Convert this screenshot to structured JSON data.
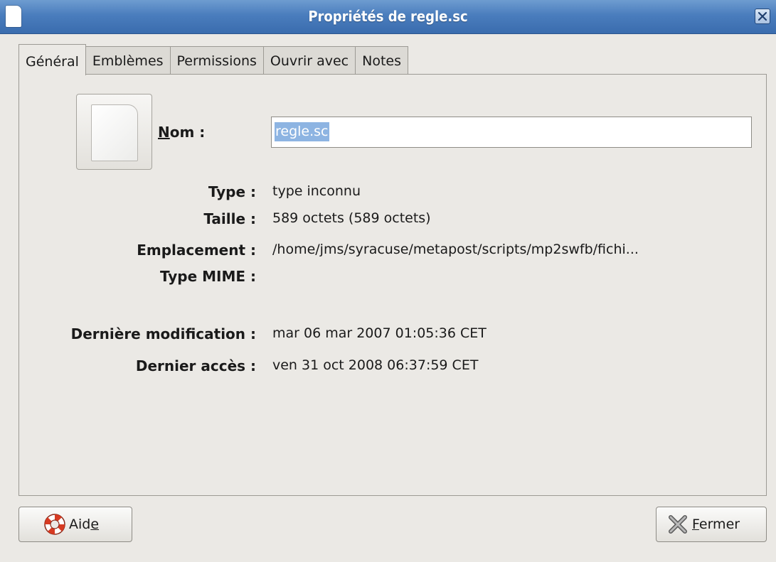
{
  "window": {
    "title": "Propriétés de regle.sc",
    "doc_icon": "document-icon",
    "close_icon": "close-icon"
  },
  "tabs": [
    {
      "label": "Général",
      "active": true
    },
    {
      "label": "Emblèmes",
      "active": false
    },
    {
      "label": "Permissions",
      "active": false
    },
    {
      "label": "Ouvrir avec",
      "active": false
    },
    {
      "label": "Notes",
      "active": false
    }
  ],
  "general": {
    "file_icon": "file-icon",
    "name_label_mnemonic": "N",
    "name_label_rest": "om :",
    "name_value": "regle.sc",
    "fields": [
      {
        "label": "Type :",
        "value": "type inconnu"
      },
      {
        "label": "Taille :",
        "value": "589 octets (589 octets)"
      },
      {
        "label": "Emplacement :",
        "value": "/home/jms/syracuse/metapost/scripts/mp2swfb/fichi..."
      },
      {
        "label": "Type MIME :",
        "value": ""
      }
    ],
    "dates": [
      {
        "label": "Dernière modification :",
        "value": "mar 06 mar 2007 01:05:36 CET"
      },
      {
        "label": "Dernier accès :",
        "value": "ven 31 oct 2008 06:37:59 CET"
      }
    ]
  },
  "buttons": {
    "help": {
      "pre": "Aid",
      "mnemonic": "e",
      "icon": "lifebuoy-icon"
    },
    "close": {
      "mnemonic": "F",
      "post": "ermer",
      "icon": "close-x-icon"
    }
  },
  "colors": {
    "titlebar": "#4a7dbd",
    "selection": "#8db4e2",
    "background": "#ebe9e5"
  }
}
